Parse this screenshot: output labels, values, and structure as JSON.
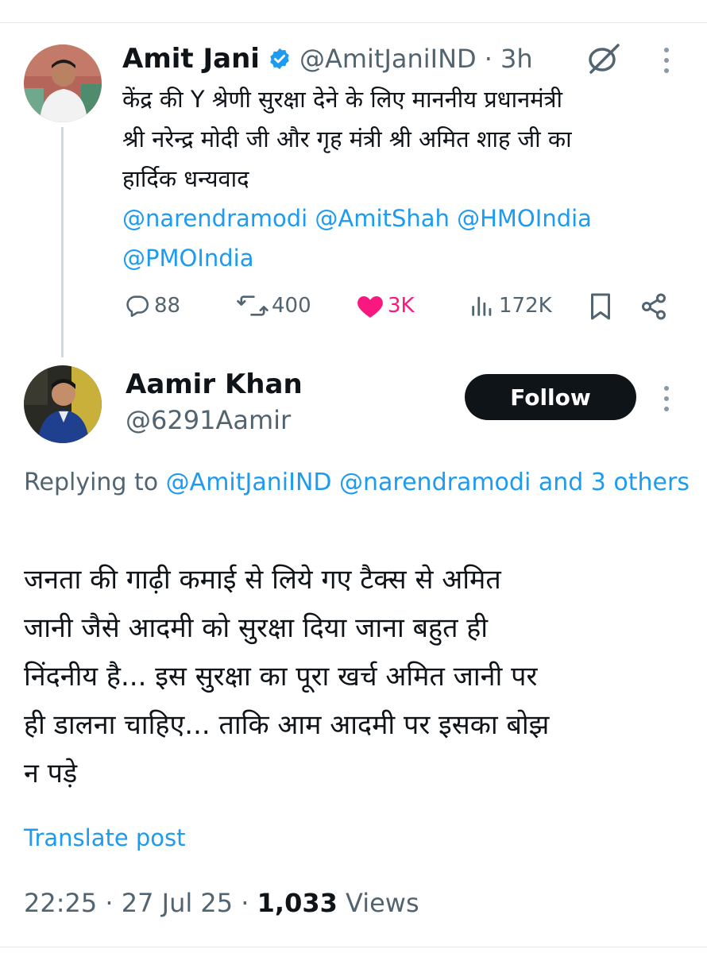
{
  "parent_tweet": {
    "author_name": "Amit Jani",
    "handle": "@AmitJaniIND",
    "time": "· 3h",
    "text_lines": [
      "केंद्र की Y श्रेणी सुरक्षा देने के लिए माननीय प्रधानमंत्री",
      "श्री नरेन्द्र मोदी जी और गृह मंत्री श्री अमित शाह जी का",
      "हार्दिक धन्यवाद"
    ],
    "mention_lines": [
      "@narendramodi @AmitShah @HMOIndia",
      "@PMOIndia"
    ],
    "metrics": {
      "replies": "88",
      "reposts": "400",
      "likes": "3K",
      "views": "172K"
    }
  },
  "reply": {
    "author_name": "Aamir Khan",
    "handle": "@6291Aamir",
    "follow_label": "Follow",
    "replying_prefix": "Replying to ",
    "replying_mentions": "@AmitJaniIND @narendramodi",
    "replying_and": " and ",
    "replying_others": "3 others",
    "text_lines": [
      "जनता की गाढ़ी कमाई से लिये गए टैक्स से अमित",
      "जानी जैसे आदमी को सुरक्षा दिया जाना बहुत ही",
      "निंदनीय है... इस सुरक्षा का पूरा खर्च अमित जानी पर",
      "ही डालना चाहिए... ताकि आम आदमी पर इसका बोझ",
      "न पड़े"
    ],
    "translate_label": "Translate post",
    "timestamp": "22:25 · 27 Jul 25 · ",
    "views_count": "1,033",
    "views_label": " Views"
  },
  "colors": {
    "accent": "#1d9bf0",
    "like": "#f91880",
    "text": "#0f1419",
    "secondary": "#536471"
  },
  "icons": [
    "verified-badge-icon",
    "grok-icon",
    "more-icon",
    "reply-icon",
    "repost-icon",
    "heart-icon",
    "views-icon",
    "bookmark-icon",
    "share-icon"
  ]
}
